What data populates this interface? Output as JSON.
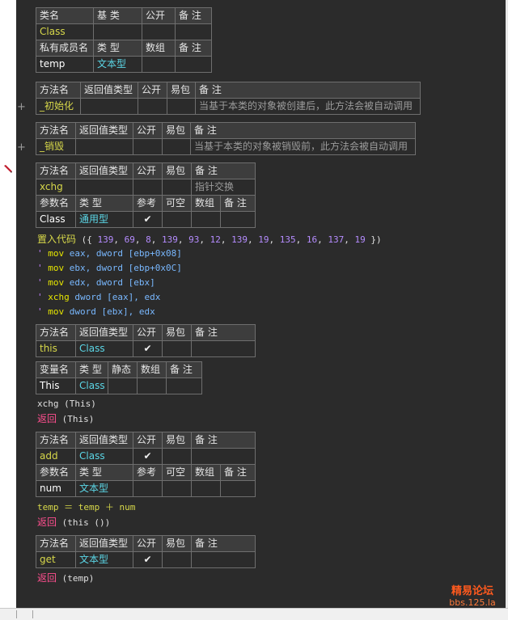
{
  "class_table": {
    "headers": [
      "类名",
      "基 类",
      "公开",
      "备 注"
    ],
    "row": [
      "Class",
      "",
      "",
      ""
    ],
    "member_headers": [
      "私有成员名",
      "类 型",
      "数组",
      "备 注"
    ],
    "member_row": [
      "temp",
      "文本型",
      "",
      ""
    ]
  },
  "init_method": {
    "headers": [
      "方法名",
      "返回值类型",
      "公开",
      "易包",
      "备 注"
    ],
    "row": [
      "_初始化",
      "",
      "",
      "",
      "当基于本类的对象被创建后，此方法会被自动调用"
    ]
  },
  "destroy_method": {
    "headers": [
      "方法名",
      "返回值类型",
      "公开",
      "易包",
      "备 注"
    ],
    "row": [
      "_销毁",
      "",
      "",
      "",
      "当基于本类的对象被销毁前，此方法会被自动调用"
    ]
  },
  "xchg_method": {
    "headers": [
      "方法名",
      "返回值类型",
      "公开",
      "易包",
      "备 注"
    ],
    "row": [
      "xchg",
      "",
      "",
      "",
      "指针交换"
    ],
    "param_headers": [
      "参数名",
      "类 型",
      "参考",
      "可空",
      "数组",
      "备 注"
    ],
    "param_row": [
      "Class",
      "通用型",
      "✔",
      "",
      "",
      ""
    ]
  },
  "code_xchg": {
    "keyword": "置入代码",
    "open": " ({ ",
    "bytes": [
      "139",
      "69",
      "8",
      "139",
      "93",
      "12",
      "139",
      "19",
      "135",
      "16",
      "137",
      "19"
    ],
    "close": " })",
    "asm": [
      {
        "op": "mov",
        "rest": "eax, dword [ebp+0x08]"
      },
      {
        "op": "mov",
        "rest": "ebx, dword [ebp+0x0C]"
      },
      {
        "op": "mov",
        "rest": "edx, dword [ebx]"
      },
      {
        "op": "xchg",
        "rest": "dword [eax], edx"
      },
      {
        "op": "mov",
        "rest": "dword [ebx], edx"
      }
    ]
  },
  "this_method": {
    "headers": [
      "方法名",
      "返回值类型",
      "公开",
      "易包",
      "备 注"
    ],
    "row": [
      "this",
      "Class",
      "✔",
      "",
      ""
    ],
    "var_headers": [
      "变量名",
      "类 型",
      "静态",
      "数组",
      "备 注"
    ],
    "var_row": [
      "This",
      "Class",
      "",
      "",
      ""
    ]
  },
  "code_this": {
    "call": "xchg (This)",
    "ret_kw": "返回",
    "ret_arg": " (This)"
  },
  "add_method": {
    "headers": [
      "方法名",
      "返回值类型",
      "公开",
      "易包",
      "备 注"
    ],
    "row": [
      "add",
      "Class",
      "✔",
      "",
      ""
    ],
    "param_headers": [
      "参数名",
      "类 型",
      "参考",
      "可空",
      "数组",
      "备 注"
    ],
    "param_row": [
      "num",
      "文本型",
      "",
      "",
      "",
      ""
    ]
  },
  "code_add": {
    "assign": "temp ＝ temp ＋ num",
    "ret_kw": "返回",
    "ret_arg": " (this ())"
  },
  "get_method": {
    "headers": [
      "方法名",
      "返回值类型",
      "公开",
      "易包",
      "备 注"
    ],
    "row": [
      "get",
      "文本型",
      "✔",
      "",
      ""
    ]
  },
  "code_get": {
    "ret_kw": "返回",
    "ret_arg": " (temp)"
  },
  "watermark": {
    "line1": "精易论坛",
    "line2": "bbs.125.la"
  },
  "colors": {
    "background": "#2b2b2b",
    "keyword": "#ff4f8f",
    "identifier": "#d7d84a",
    "type": "#5bd6e6",
    "number": "#b58cff"
  }
}
